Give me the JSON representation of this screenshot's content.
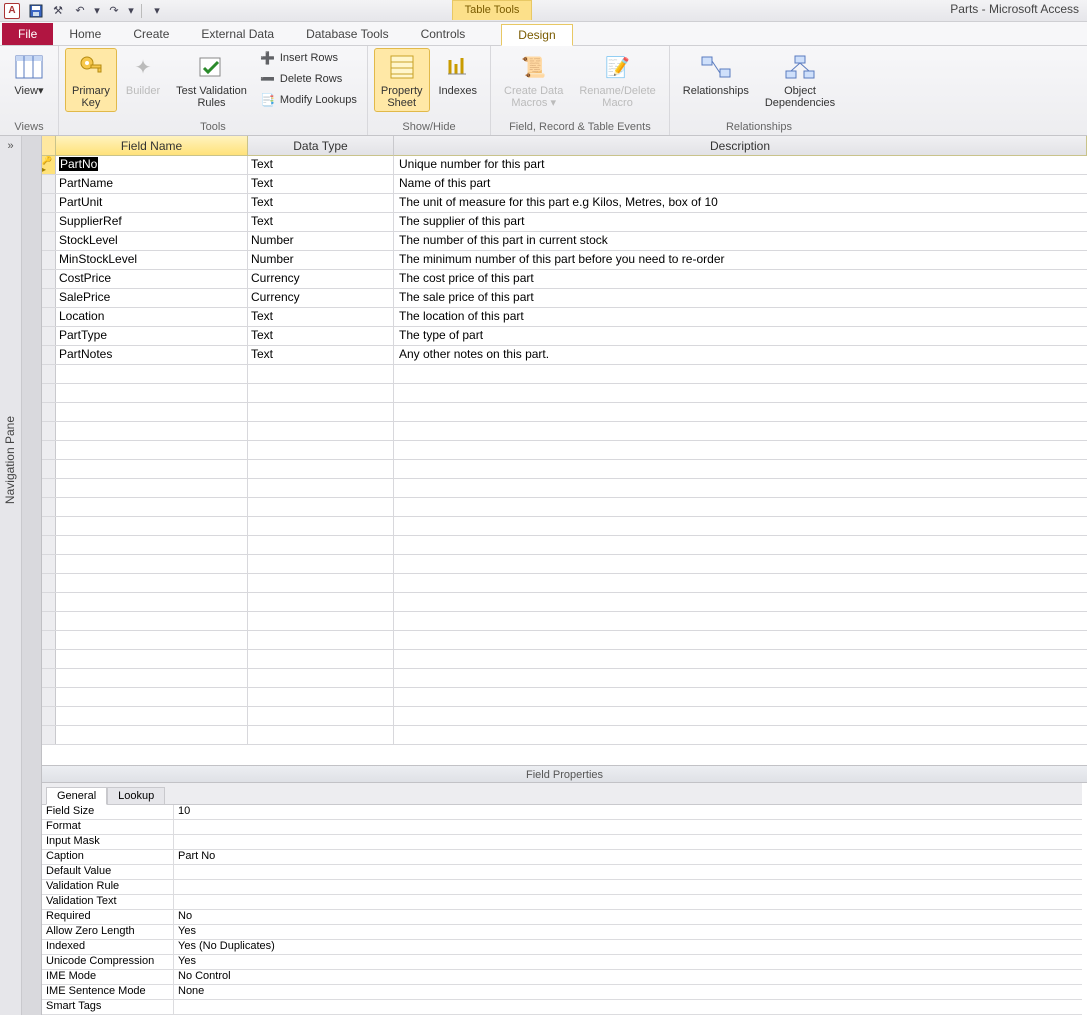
{
  "window_title": "Parts  -  Microsoft Access",
  "qat": {
    "app_letter": "A"
  },
  "tabletools_caption": "Table Tools",
  "menu": {
    "file": "File",
    "tabs": [
      "Home",
      "Create",
      "External Data",
      "Database Tools",
      "Controls"
    ],
    "context_tab": "Design"
  },
  "ribbon": {
    "views": {
      "view": "View",
      "label": "Views"
    },
    "tools": {
      "primary_key": "Primary\nKey",
      "builder": "Builder",
      "test_validation": "Test Validation\nRules",
      "insert_rows": "Insert Rows",
      "delete_rows": "Delete Rows",
      "modify_lookups": "Modify Lookups",
      "label": "Tools"
    },
    "showhide": {
      "property_sheet": "Property\nSheet",
      "indexes": "Indexes",
      "label": "Show/Hide"
    },
    "events": {
      "create_macros": "Create Data\nMacros ▾",
      "rename_macro": "Rename/Delete\nMacro",
      "label": "Field, Record & Table Events"
    },
    "relationships": {
      "relationships": "Relationships",
      "obj_dep": "Object\nDependencies",
      "label": "Relationships"
    }
  },
  "nav_pane_label": "Navigation Pane",
  "grid": {
    "headers": {
      "field": "Field Name",
      "type": "Data Type",
      "desc": "Description"
    },
    "rows": [
      {
        "pk": true,
        "name": "PartNo",
        "type": "Text",
        "desc": "Unique number for this part"
      },
      {
        "pk": false,
        "name": "PartName",
        "type": "Text",
        "desc": "Name of this part"
      },
      {
        "pk": false,
        "name": "PartUnit",
        "type": "Text",
        "desc": "The unit of measure for this part e.g Kilos, Metres, box of 10"
      },
      {
        "pk": false,
        "name": "SupplierRef",
        "type": "Text",
        "desc": "The supplier of this part"
      },
      {
        "pk": false,
        "name": "StockLevel",
        "type": "Number",
        "desc": "The number of this part in current stock"
      },
      {
        "pk": false,
        "name": "MinStockLevel",
        "type": "Number",
        "desc": "The minimum number of this part before you need to re-order"
      },
      {
        "pk": false,
        "name": "CostPrice",
        "type": "Currency",
        "desc": "The cost price of this part"
      },
      {
        "pk": false,
        "name": "SalePrice",
        "type": "Currency",
        "desc": "The sale price of this part"
      },
      {
        "pk": false,
        "name": "Location",
        "type": "Text",
        "desc": "The location of this part"
      },
      {
        "pk": false,
        "name": "PartType",
        "type": "Text",
        "desc": "The type of part"
      },
      {
        "pk": false,
        "name": "PartNotes",
        "type": "Text",
        "desc": "Any other notes on this part."
      }
    ],
    "empty_rows": 20
  },
  "field_properties": {
    "title": "Field Properties",
    "tabs": {
      "general": "General",
      "lookup": "Lookup"
    },
    "rows": [
      {
        "k": "Field Size",
        "v": "10"
      },
      {
        "k": "Format",
        "v": ""
      },
      {
        "k": "Input Mask",
        "v": ""
      },
      {
        "k": "Caption",
        "v": "Part No"
      },
      {
        "k": "Default Value",
        "v": ""
      },
      {
        "k": "Validation Rule",
        "v": ""
      },
      {
        "k": "Validation Text",
        "v": ""
      },
      {
        "k": "Required",
        "v": "No"
      },
      {
        "k": "Allow Zero Length",
        "v": "Yes"
      },
      {
        "k": "Indexed",
        "v": "Yes (No Duplicates)"
      },
      {
        "k": "Unicode Compression",
        "v": "Yes"
      },
      {
        "k": "IME Mode",
        "v": "No Control"
      },
      {
        "k": "IME Sentence Mode",
        "v": "None"
      },
      {
        "k": "Smart Tags",
        "v": ""
      }
    ]
  }
}
